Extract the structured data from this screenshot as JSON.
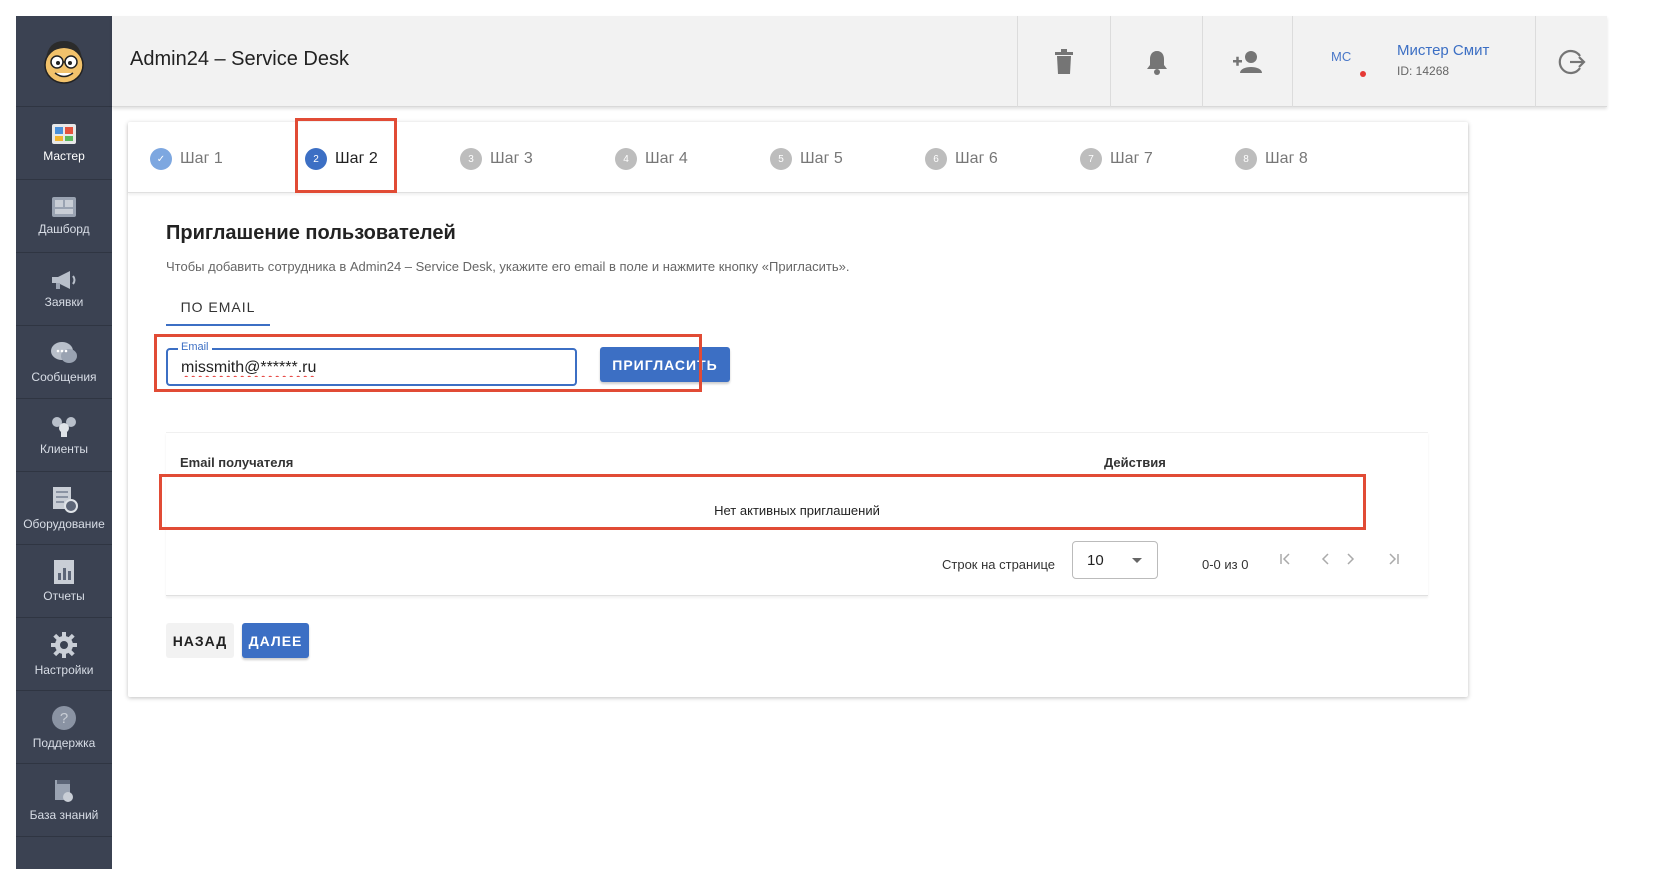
{
  "app": {
    "title": "Admin24 – Service Desk"
  },
  "sidebar": {
    "items": [
      {
        "label": "Мастер",
        "icon": "wizard-icon"
      },
      {
        "label": "Дашборд",
        "icon": "dashboard-icon"
      },
      {
        "label": "Заявки",
        "icon": "megaphone-icon"
      },
      {
        "label": "Сообщения",
        "icon": "chat-icon"
      },
      {
        "label": "Клиенты",
        "icon": "clients-icon"
      },
      {
        "label": "Оборудование",
        "icon": "equipment-icon"
      },
      {
        "label": "Отчеты",
        "icon": "reports-icon"
      },
      {
        "label": "Настройки",
        "icon": "gear-icon"
      },
      {
        "label": "Поддержка",
        "icon": "help-icon"
      },
      {
        "label": "База знаний",
        "icon": "knowledge-base-icon"
      }
    ]
  },
  "header": {
    "icons": [
      "trash-icon",
      "bell-icon",
      "add-user-icon",
      "logout-icon"
    ],
    "user": {
      "initials": "МС",
      "name": "Мистер Смит",
      "id": "ID: 14268"
    }
  },
  "stepper": {
    "steps": [
      {
        "num": "✓",
        "label": "Шаг 1",
        "state": "done"
      },
      {
        "num": "2",
        "label": "Шаг 2",
        "state": "active"
      },
      {
        "num": "3",
        "label": "Шаг 3",
        "state": "pending"
      },
      {
        "num": "4",
        "label": "Шаг 4",
        "state": "pending"
      },
      {
        "num": "5",
        "label": "Шаг 5",
        "state": "pending"
      },
      {
        "num": "6",
        "label": "Шаг 6",
        "state": "pending"
      },
      {
        "num": "7",
        "label": "Шаг 7",
        "state": "pending"
      },
      {
        "num": "8",
        "label": "Шаг 8",
        "state": "pending"
      }
    ]
  },
  "invite": {
    "title": "Приглашение пользователей",
    "description": "Чтобы добавить сотрудника в Admin24 – Service Desk, укажите его email в поле и нажмите кнопку «Пригласить».",
    "tab_label": "ПО EMAIL",
    "email_label": "Email",
    "email_value": "missmith@******.ru",
    "invite_button": "ПРИГЛАСИТЬ"
  },
  "table": {
    "col_email": "Email получателя",
    "col_actions": "Действия",
    "empty_text": "Нет активных приглашений",
    "rows_per_page_label": "Строк на странице",
    "rows_per_page_value": "10",
    "range_text": "0-0 из 0"
  },
  "footer": {
    "back_button": "НАЗАД",
    "next_button": "ДАЛЕЕ"
  },
  "colors": {
    "sidebar": "#3b4252",
    "accent": "#3c6fc4",
    "highlight": "#e14b35",
    "header": "#f2f2f2"
  }
}
